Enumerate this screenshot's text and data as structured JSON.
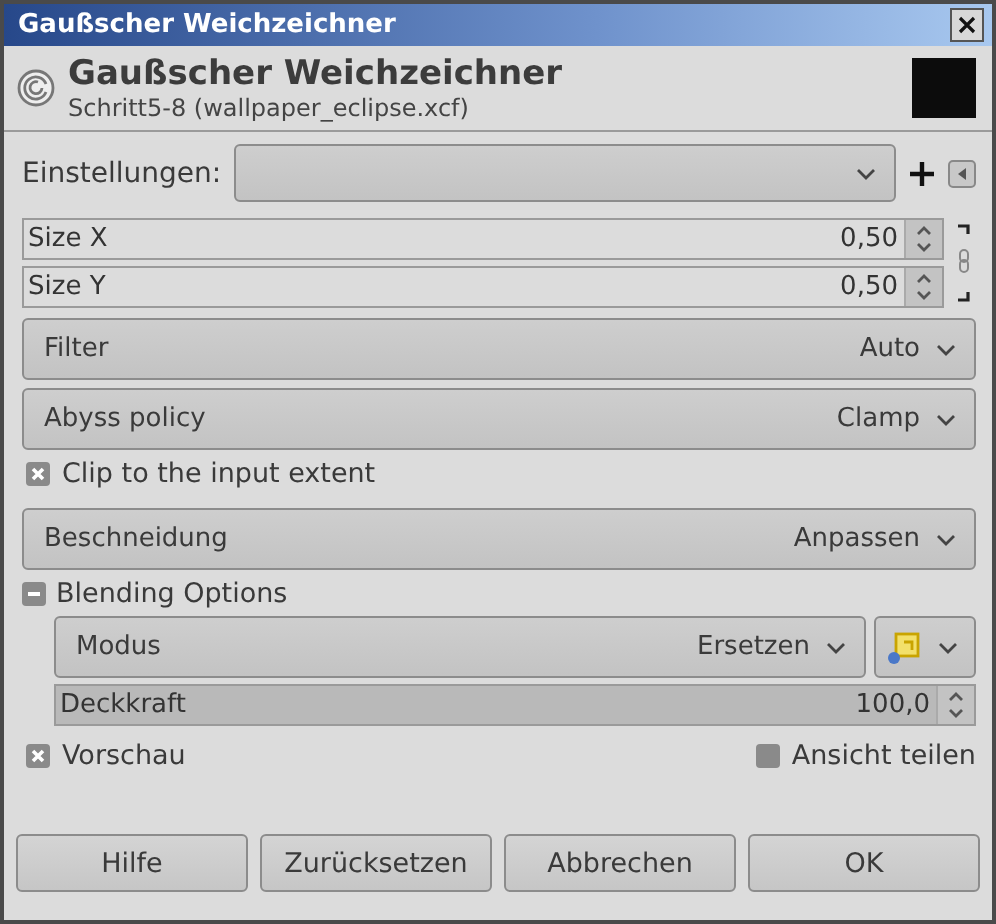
{
  "window": {
    "title": "Gaußscher Weichzeichner"
  },
  "header": {
    "title": "Gaußscher Weichzeichner",
    "subtitle": "Schritt5-8 (wallpaper_eclipse.xcf)"
  },
  "presets": {
    "label": "Einstellungen:"
  },
  "size": [
    {
      "label": "Size X",
      "value": "0,50"
    },
    {
      "label": "Size Y",
      "value": "0,50"
    }
  ],
  "options": [
    {
      "label": "Filter",
      "value": "Auto"
    },
    {
      "label": "Abyss policy",
      "value": "Clamp"
    }
  ],
  "clip": {
    "label": "Clip to the input extent",
    "checked": true
  },
  "clipping": {
    "label": "Beschneidung",
    "value": "Anpassen"
  },
  "blending": {
    "label": "Blending Options",
    "expanded": true,
    "mode": {
      "label": "Modus",
      "value": "Ersetzen"
    },
    "opacity": {
      "label": "Deckkraft",
      "value": "100,0",
      "level": 1
    }
  },
  "preview": {
    "label": "Vorschau",
    "checked": true
  },
  "split_view": {
    "label": "Ansicht teilen",
    "checked": false
  },
  "buttons": [
    "Hilfe",
    "Zurücksetzen",
    "Abbrechen",
    "OK"
  ]
}
